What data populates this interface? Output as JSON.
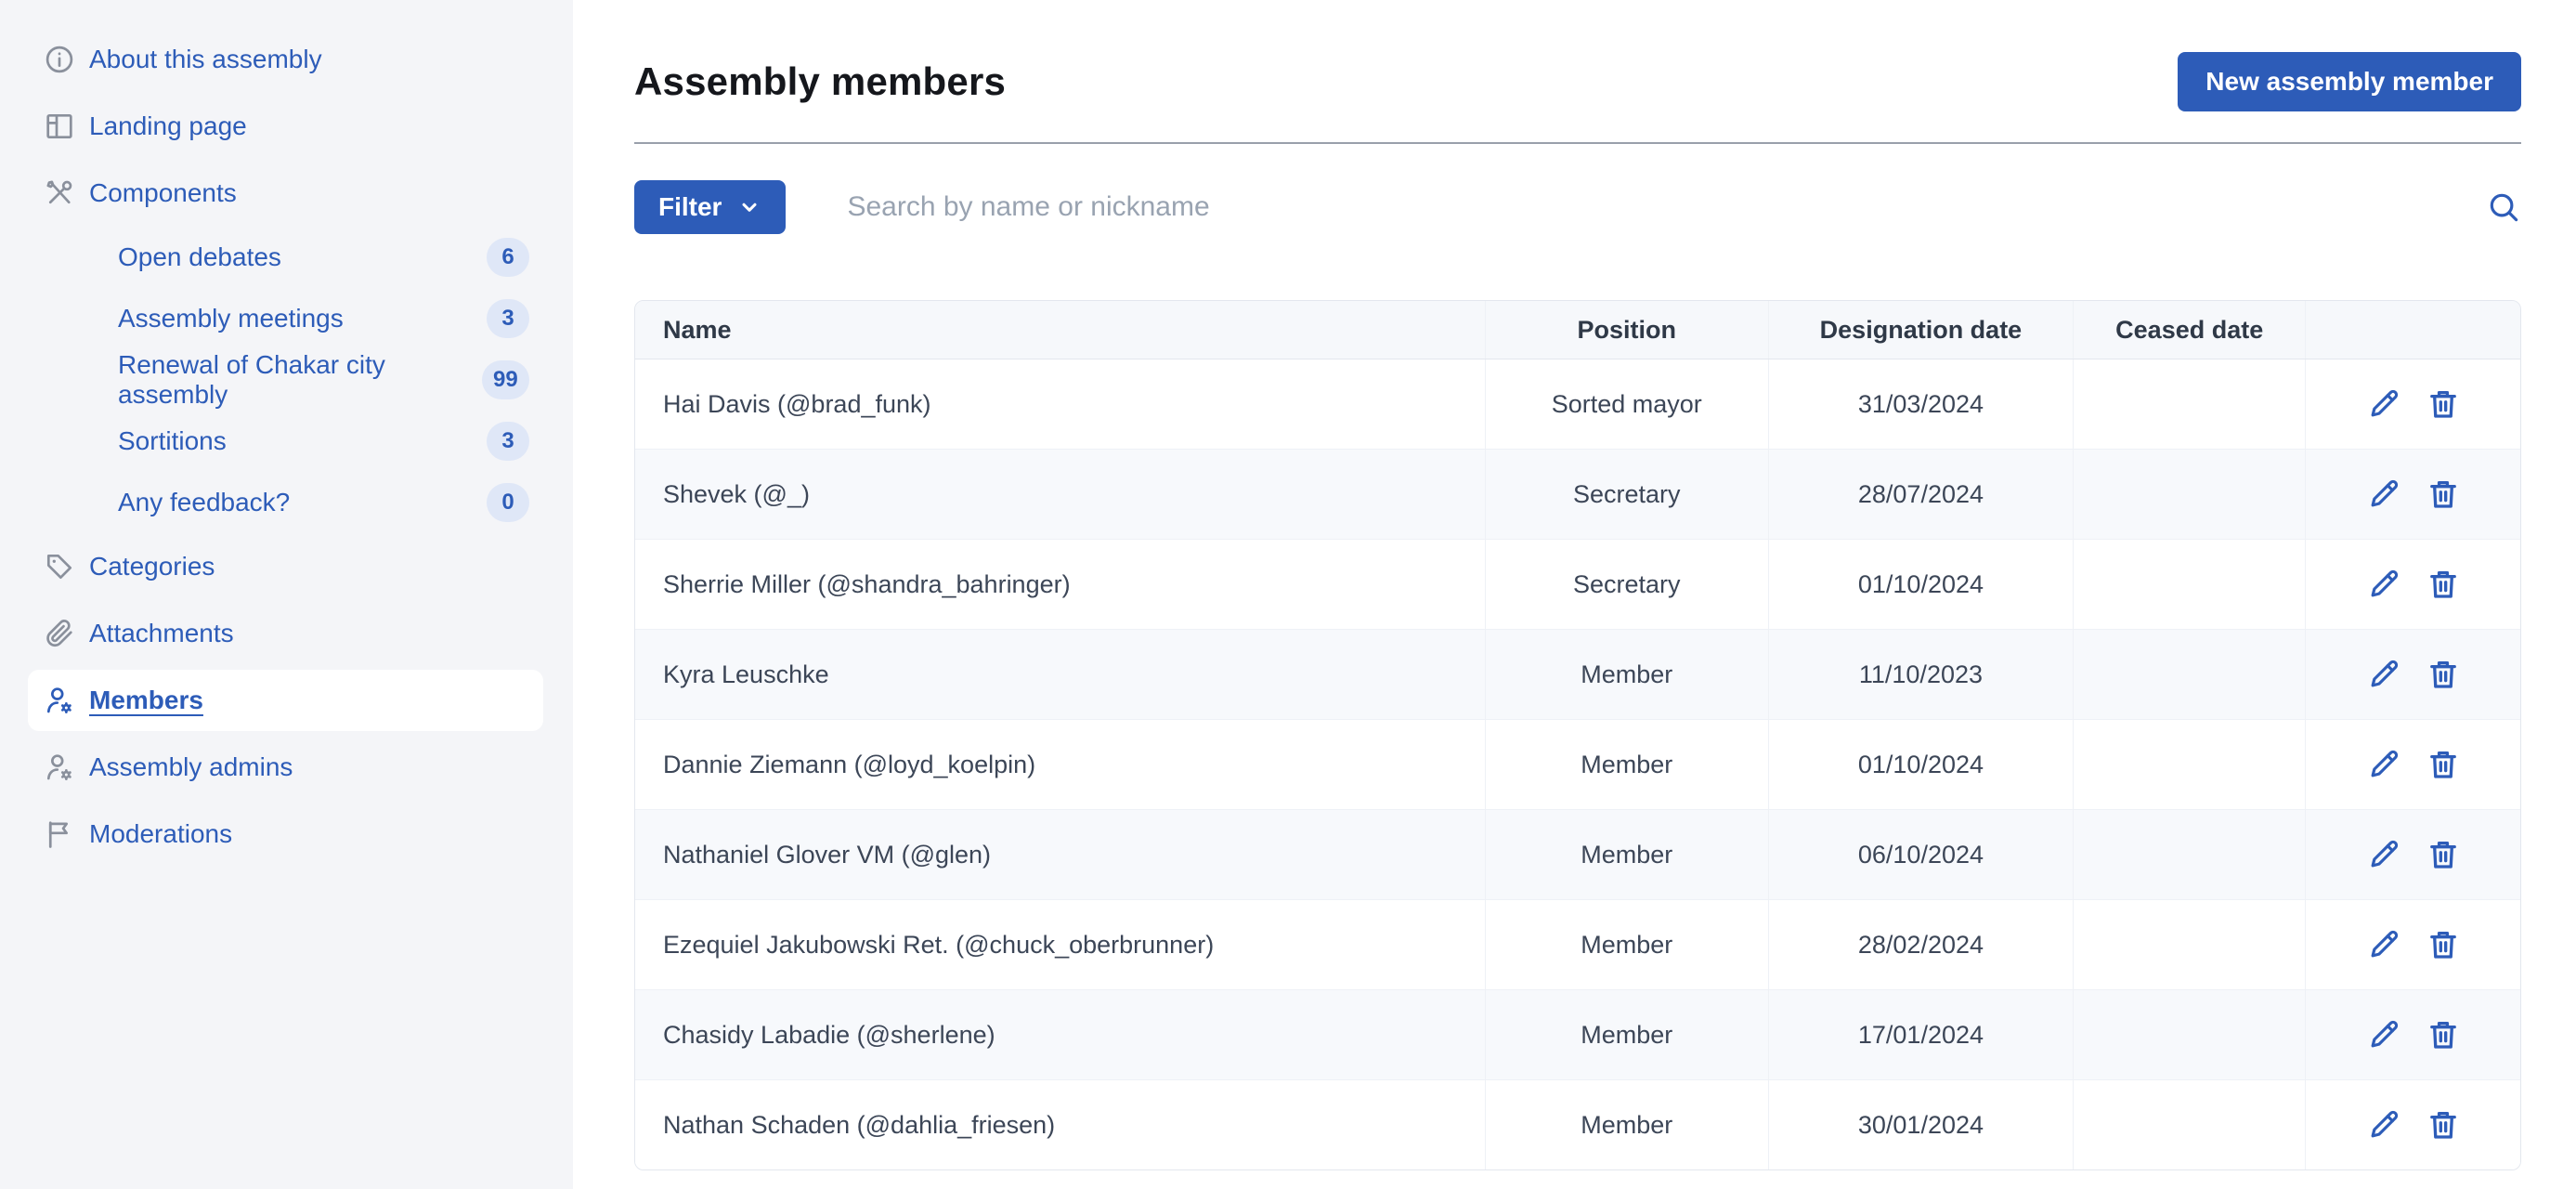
{
  "colors": {
    "accent_blue": "#2d5cb8",
    "sidebar_bg": "#f4f5f8",
    "badge_bg": "#dfe7f7",
    "table_header_bg": "#f6f8fb",
    "row_alt_bg": "#f7f9fc"
  },
  "sidebar": {
    "items": [
      {
        "label": "About this assembly",
        "icon": "info-icon"
      },
      {
        "label": "Landing page",
        "icon": "layout-icon"
      },
      {
        "label": "Components",
        "icon": "tools-icon"
      },
      {
        "label": "Open debates",
        "sub": true,
        "badge": "6"
      },
      {
        "label": "Assembly meetings",
        "sub": true,
        "badge": "3"
      },
      {
        "label": "Renewal of Chakar city assembly",
        "sub": true,
        "badge": "99"
      },
      {
        "label": "Sortitions",
        "sub": true,
        "badge": "3"
      },
      {
        "label": "Any feedback?",
        "sub": true,
        "badge": "0"
      },
      {
        "label": "Categories",
        "icon": "tag-icon"
      },
      {
        "label": "Attachments",
        "icon": "paperclip-icon"
      },
      {
        "label": "Members",
        "icon": "user-gear-icon",
        "active": true
      },
      {
        "label": "Assembly admins",
        "icon": "user-gear-icon"
      },
      {
        "label": "Moderations",
        "icon": "flag-icon"
      }
    ]
  },
  "header": {
    "title": "Assembly members",
    "new_button_label": "New assembly member"
  },
  "toolbar": {
    "filter_label": "Filter",
    "search_placeholder": "Search by name or nickname"
  },
  "table": {
    "columns": [
      "Name",
      "Position",
      "Designation date",
      "Ceased date",
      ""
    ],
    "rows": [
      {
        "name": "Hai Davis (@brad_funk)",
        "position": "Sorted mayor",
        "designation_date": "31/03/2024",
        "ceased_date": ""
      },
      {
        "name": "Shevek (@_)",
        "position": "Secretary",
        "designation_date": "28/07/2024",
        "ceased_date": ""
      },
      {
        "name": "Sherrie Miller (@shandra_bahringer)",
        "position": "Secretary",
        "designation_date": "01/10/2024",
        "ceased_date": ""
      },
      {
        "name": "Kyra Leuschke",
        "position": "Member",
        "designation_date": "11/10/2023",
        "ceased_date": ""
      },
      {
        "name": "Dannie Ziemann (@loyd_koelpin)",
        "position": "Member",
        "designation_date": "01/10/2024",
        "ceased_date": ""
      },
      {
        "name": "Nathaniel Glover VM (@glen)",
        "position": "Member",
        "designation_date": "06/10/2024",
        "ceased_date": ""
      },
      {
        "name": "Ezequiel Jakubowski Ret. (@chuck_oberbrunner)",
        "position": "Member",
        "designation_date": "28/02/2024",
        "ceased_date": ""
      },
      {
        "name": "Chasidy Labadie (@sherlene)",
        "position": "Member",
        "designation_date": "17/01/2024",
        "ceased_date": ""
      },
      {
        "name": "Nathan Schaden (@dahlia_friesen)",
        "position": "Member",
        "designation_date": "30/01/2024",
        "ceased_date": ""
      }
    ]
  }
}
